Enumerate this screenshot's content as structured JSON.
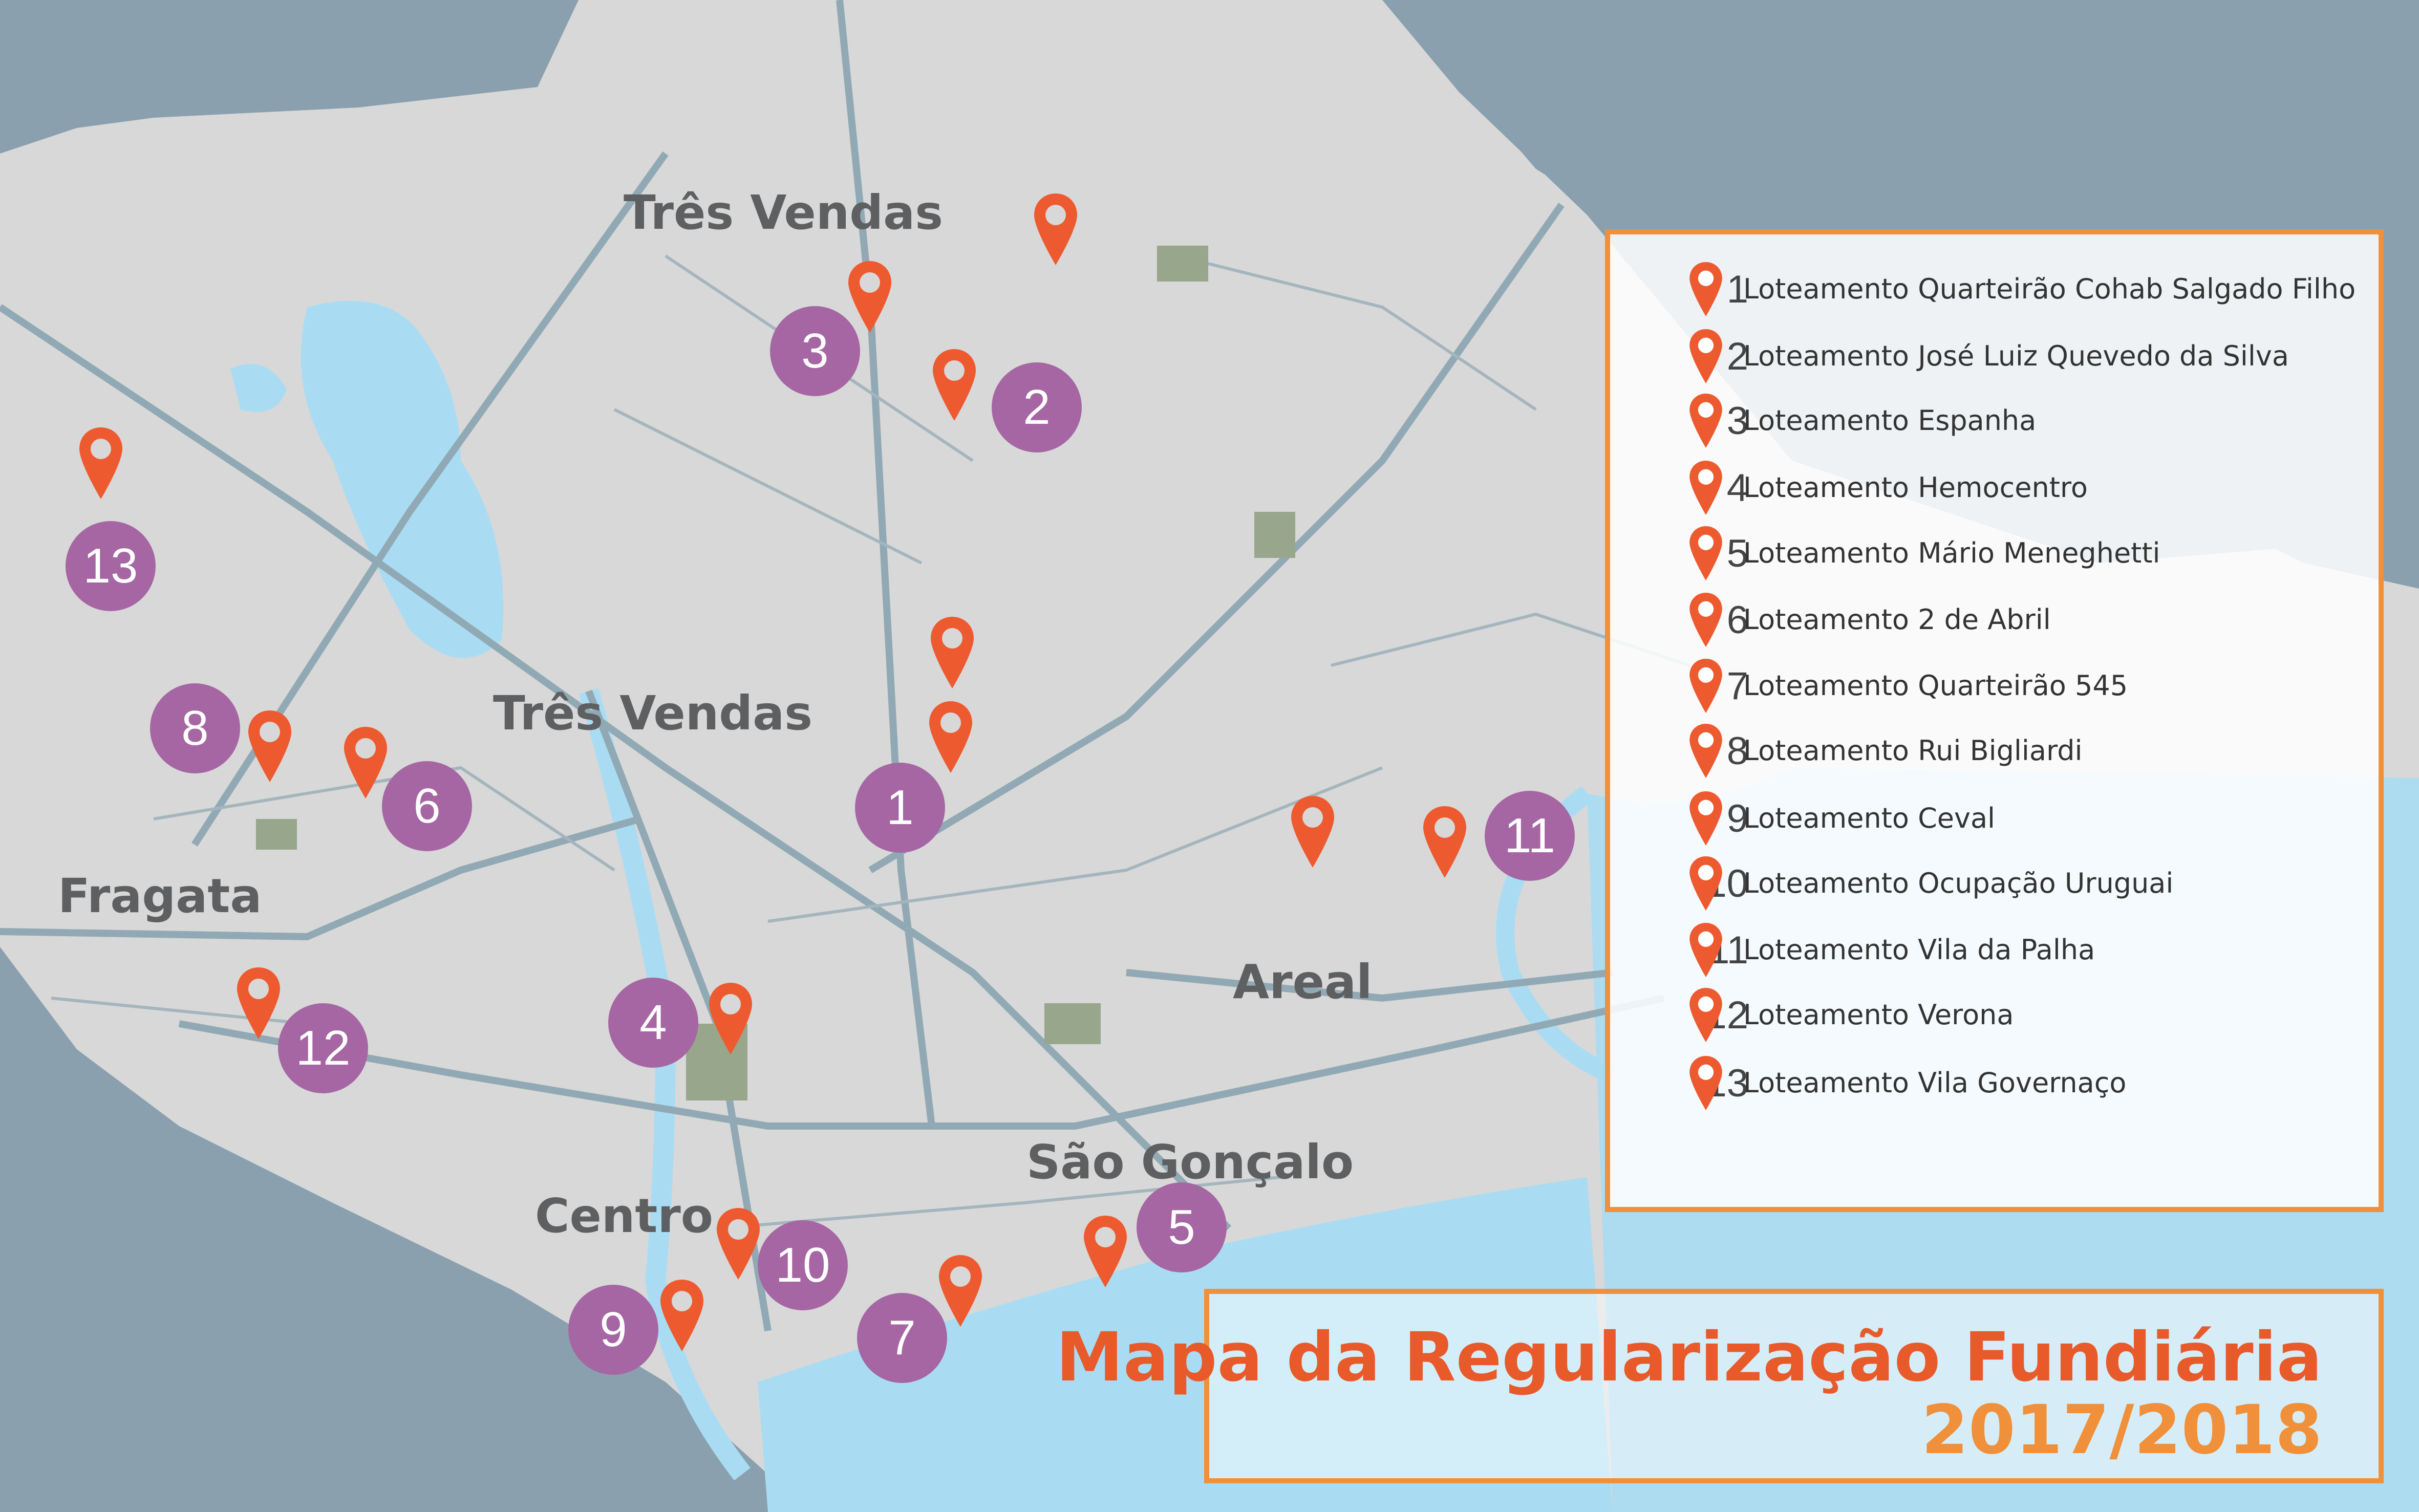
{
  "title": {
    "main": "Mapa da Regularização Fundiária",
    "year": "2017/2018"
  },
  "districts": {
    "tres_vendas_north": "Três Vendas",
    "tres_vendas_west": "Três Vendas",
    "fragata": "Fragata",
    "areal": "Areal",
    "sao_goncalo": "São Gonçalo",
    "centro": "Centro"
  },
  "markers": [
    "1",
    "2",
    "3",
    "4",
    "5",
    "6",
    "7",
    "8",
    "9",
    "10",
    "11",
    "12",
    "13"
  ],
  "legend": [
    {
      "num": "1",
      "label": "Loteamento Quarteirão Cohab Salgado Filho"
    },
    {
      "num": "2",
      "label": "Loteamento José Luiz Quevedo da Silva"
    },
    {
      "num": "3",
      "label": "Loteamento Espanha"
    },
    {
      "num": "4",
      "label": "Loteamento Hemocentro"
    },
    {
      "num": "5",
      "label": "Loteamento Mário Meneghetti"
    },
    {
      "num": "6",
      "label": "Loteamento 2 de Abril"
    },
    {
      "num": "7",
      "label": "Loteamento Quarteirão 545"
    },
    {
      "num": "8",
      "label": "Loteamento Rui Bigliardi"
    },
    {
      "num": "9",
      "label": "Loteamento Ceval"
    },
    {
      "num": "10",
      "label": "Loteamento Ocupação Uruguai"
    },
    {
      "num": "11",
      "label": "Loteamento Vila da Palha"
    },
    {
      "num": "12",
      "label": "Loteamento Verona"
    },
    {
      "num": "13",
      "label": "Loteamento Vila Governaço"
    }
  ],
  "colors": {
    "pin": "#ee5a2f",
    "marker_circle": "#a566a3",
    "frame": "#f0903a",
    "land": "#d8d8d8",
    "water_dark": "#8aa0ae",
    "water_light": "#a9dcf3"
  }
}
